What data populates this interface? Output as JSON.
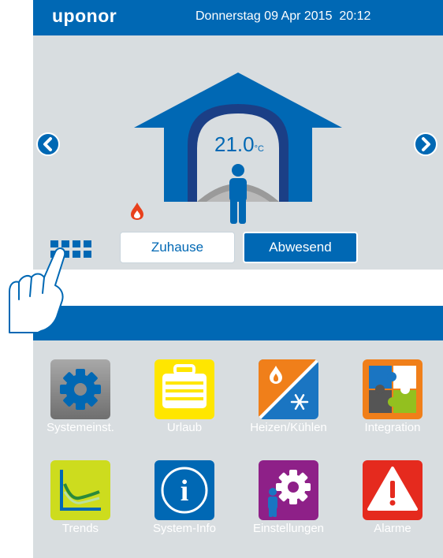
{
  "header": {
    "brand": "uponor",
    "datetime": "Donnerstag 09 Apr 2015  20:12"
  },
  "room": {
    "temperature": "21.0",
    "unit": "°C"
  },
  "modes": {
    "home": "Zuhause",
    "away": "Abwesend"
  },
  "menu": [
    {
      "label": "Systemeinst.",
      "icon": "gear-icon"
    },
    {
      "label": "Urlaub",
      "icon": "suitcase-icon"
    },
    {
      "label": "Heizen/Kühlen",
      "icon": "heat-cool-icon"
    },
    {
      "label": "Integration",
      "icon": "puzzle-icon"
    },
    {
      "label": "Trends",
      "icon": "trend-chart-icon"
    },
    {
      "label": "System-Info",
      "icon": "info-icon"
    },
    {
      "label": "Einstellungen",
      "icon": "person-gear-icon"
    },
    {
      "label": "Alarme",
      "icon": "warning-icon"
    }
  ],
  "colors": {
    "brand": "#0068b4",
    "panel": "#d8dde0",
    "heat": "#e8401c",
    "cool": "#1a75c2"
  }
}
